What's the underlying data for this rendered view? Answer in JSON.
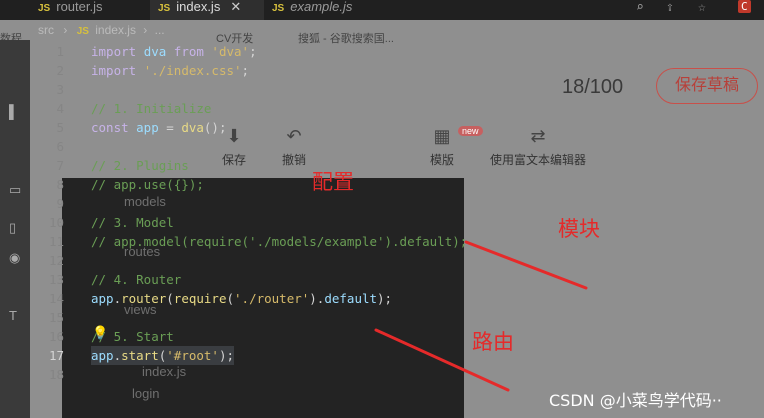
{
  "tabs": [
    {
      "label": "router.js",
      "active": false
    },
    {
      "label": "index.js",
      "active": true
    },
    {
      "label": "example.js",
      "active": false
    }
  ],
  "breadcrumb": {
    "folder": "src",
    "file": "index.js",
    "more": "..."
  },
  "background_page": {
    "bookmarks": [
      "数程",
      "CV开发",
      "搜狐 - 谷歌搜索国..."
    ],
    "word_count": "18/100",
    "save_draft": "保存草稿",
    "toolbar": [
      "保存",
      "撤销",
      "模版",
      "使用富文本编辑器"
    ],
    "new_badge": "new"
  },
  "explorer_ghost": [
    "models",
    "routes",
    "views",
    "index.js",
    "login"
  ],
  "code_lines": [
    {
      "n": "1",
      "parts": [
        [
          "kw",
          "import "
        ],
        [
          "var",
          "dva"
        ],
        [
          "kw",
          " from "
        ],
        [
          "str",
          "'dva'"
        ],
        [
          "p",
          ";"
        ]
      ]
    },
    {
      "n": "2",
      "parts": [
        [
          "kw",
          "import "
        ],
        [
          "str",
          "'./index.css'"
        ],
        [
          "p",
          ";"
        ]
      ]
    },
    {
      "n": "3",
      "parts": []
    },
    {
      "n": "4",
      "parts": [
        [
          "cm",
          "// 1. Initialize"
        ]
      ]
    },
    {
      "n": "5",
      "parts": [
        [
          "kw",
          "const "
        ],
        [
          "var",
          "app"
        ],
        [
          "p",
          " = "
        ],
        [
          "fn",
          "dva"
        ],
        [
          "p",
          "();"
        ]
      ]
    },
    {
      "n": "6",
      "parts": []
    },
    {
      "n": "7",
      "parts": [
        [
          "cm",
          "// 2. Plugins"
        ]
      ]
    },
    {
      "n": "8",
      "parts": [
        [
          "cm",
          "// app.use({});"
        ]
      ]
    },
    {
      "n": "9",
      "parts": []
    },
    {
      "n": "10",
      "parts": [
        [
          "cm",
          "// 3. Model"
        ]
      ]
    },
    {
      "n": "11",
      "parts": [
        [
          "cm",
          "// app.model(require('./models/example').default);"
        ]
      ]
    },
    {
      "n": "12",
      "parts": []
    },
    {
      "n": "13",
      "parts": [
        [
          "cm",
          "// 4. Router"
        ]
      ]
    },
    {
      "n": "14",
      "parts": [
        [
          "var",
          "app"
        ],
        [
          "p",
          "."
        ],
        [
          "fn",
          "router"
        ],
        [
          "p",
          "("
        ],
        [
          "fn",
          "require"
        ],
        [
          "p",
          "("
        ],
        [
          "str",
          "'./router'"
        ],
        [
          "p",
          ")."
        ],
        [
          "var",
          "default"
        ],
        [
          "p",
          ");"
        ]
      ]
    },
    {
      "n": "15",
      "parts": []
    },
    {
      "n": "16",
      "parts": [
        [
          "cm",
          "// 5. Start"
        ]
      ]
    },
    {
      "n": "17",
      "parts": [
        [
          "var",
          "app"
        ],
        [
          "p",
          "."
        ],
        [
          "fn",
          "start"
        ],
        [
          "p",
          "("
        ],
        [
          "str",
          "'#root'"
        ],
        [
          "p",
          ");"
        ]
      ]
    },
    {
      "n": "18",
      "parts": []
    }
  ],
  "current_line": "17",
  "annotations": {
    "config": "配置",
    "module": "模块",
    "routing": "路由"
  },
  "watermark": "CSDN @小菜鸟学代码··"
}
